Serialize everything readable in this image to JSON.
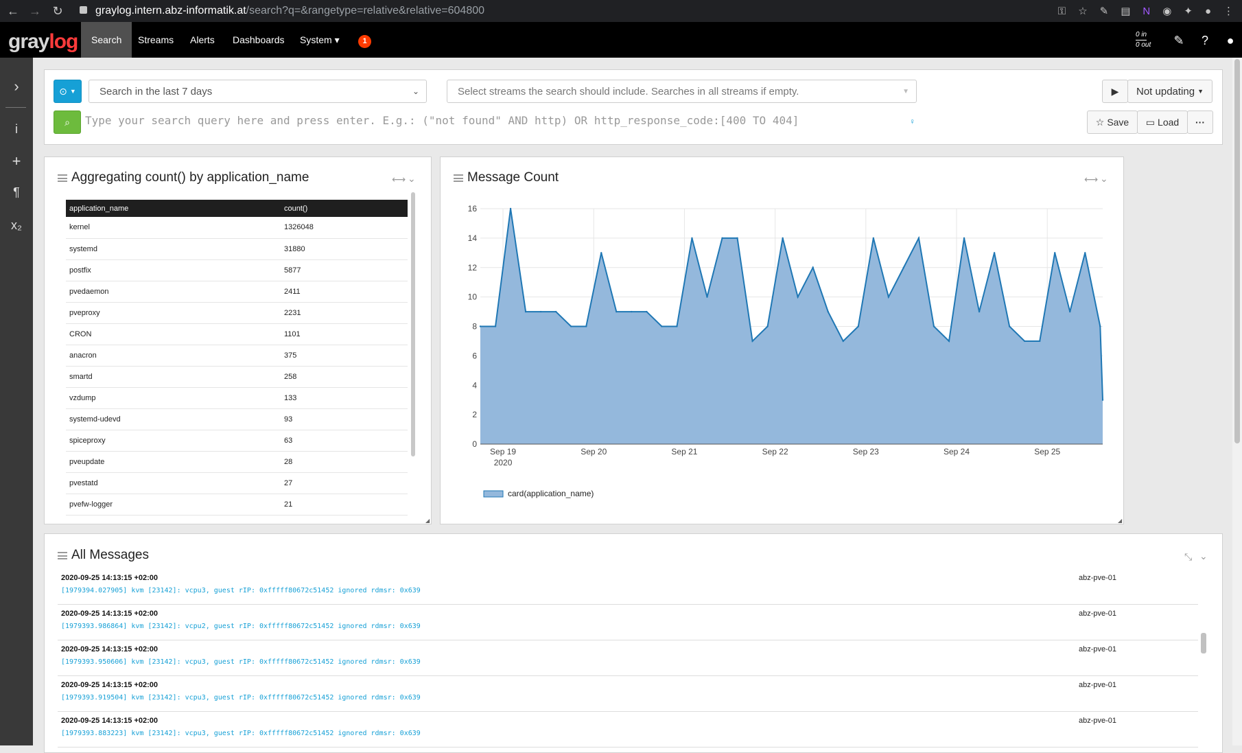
{
  "browser": {
    "url_host": "graylog.intern.abz-informatik.at",
    "url_path": "/search?q=&rangetype=relative&relative=604800"
  },
  "app": {
    "logo_gray": "gray",
    "logo_red": "log"
  },
  "nav": {
    "items": [
      "Search",
      "Streams",
      "Alerts",
      "Dashboards",
      "System ▾"
    ],
    "notifications": "1",
    "throughput_in": "0 in",
    "throughput_out": "0 out"
  },
  "search": {
    "range_button_icon": "clock-icon",
    "range_value": "Search in the last 7 days",
    "streams_placeholder": "Select streams the search should include. Searches in all streams if empty.",
    "query_placeholder": "Type your search query here and press enter. E.g.: (\"not found\" AND http) OR http_response_code:[400 TO 404]",
    "refresh_label": "Not updating",
    "save_label": "Save",
    "load_label": "Load",
    "more_label": "···"
  },
  "widgets": {
    "aggregation": {
      "title": "Aggregating count() by application_name",
      "columns": [
        "application_name",
        "count()"
      ],
      "rows": [
        [
          "kernel",
          "1326048"
        ],
        [
          "systemd",
          "31880"
        ],
        [
          "postfix",
          "5877"
        ],
        [
          "pvedaemon",
          "2411"
        ],
        [
          "pveproxy",
          "2231"
        ],
        [
          "CRON",
          "1101"
        ],
        [
          "anacron",
          "375"
        ],
        [
          "smartd",
          "258"
        ],
        [
          "vzdump",
          "133"
        ],
        [
          "systemd-udevd",
          "93"
        ],
        [
          "spiceproxy",
          "63"
        ],
        [
          "pveupdate",
          "28"
        ],
        [
          "pvestatd",
          "27"
        ],
        [
          "pvefw-logger",
          "21"
        ]
      ]
    },
    "message_count": {
      "title": "Message Count"
    },
    "all_messages": {
      "title": "All Messages",
      "messages": [
        {
          "timestamp": "2020-09-25 14:13:15 +02:00",
          "message": "[1979394.027905] kvm [23142]: vcpu3, guest rIP: 0xfffff80672c51452 ignored rdmsr: 0x639",
          "source": "abz-pve-01"
        },
        {
          "timestamp": "2020-09-25 14:13:15 +02:00",
          "message": "[1979393.986864] kvm [23142]: vcpu2, guest rIP: 0xfffff80672c51452 ignored rdmsr: 0x639",
          "source": "abz-pve-01"
        },
        {
          "timestamp": "2020-09-25 14:13:15 +02:00",
          "message": "[1979393.950606] kvm [23142]: vcpu3, guest rIP: 0xfffff80672c51452 ignored rdmsr: 0x639",
          "source": "abz-pve-01"
        },
        {
          "timestamp": "2020-09-25 14:13:15 +02:00",
          "message": "[1979393.919504] kvm [23142]: vcpu3, guest rIP: 0xfffff80672c51452 ignored rdmsr: 0x639",
          "source": "abz-pve-01"
        },
        {
          "timestamp": "2020-09-25 14:13:15 +02:00",
          "message": "[1979393.883223] kvm [23142]: vcpu3, guest rIP: 0xfffff80672c51452 ignored rdmsr: 0x639",
          "source": "abz-pve-01"
        }
      ]
    }
  },
  "chart_data": {
    "type": "area",
    "title": "",
    "xlabel": "",
    "ylabel": "",
    "x_tick_labels": [
      "Sep 19\n2020",
      "Sep 20",
      "Sep 21",
      "Sep 22",
      "Sep 23",
      "Sep 24",
      "Sep 25"
    ],
    "ylim": [
      0,
      16
    ],
    "y_ticks": [
      0,
      2,
      4,
      6,
      8,
      10,
      12,
      14,
      16
    ],
    "grid": true,
    "legend_position": "bottom-left",
    "color": "#1f77b4",
    "fill_color": "#94b8dc",
    "series": [
      {
        "name": "card(application_name)",
        "x": [
          "2020-09-18 18:00",
          "2020-09-18 22:00",
          "2020-09-19 02:00",
          "2020-09-19 06:00",
          "2020-09-19 10:00",
          "2020-09-19 14:00",
          "2020-09-19 18:00",
          "2020-09-19 22:00",
          "2020-09-20 02:00",
          "2020-09-20 06:00",
          "2020-09-20 10:00",
          "2020-09-20 14:00",
          "2020-09-20 18:00",
          "2020-09-20 22:00",
          "2020-09-21 02:00",
          "2020-09-21 06:00",
          "2020-09-21 10:00",
          "2020-09-21 14:00",
          "2020-09-21 18:00",
          "2020-09-21 22:00",
          "2020-09-22 02:00",
          "2020-09-22 06:00",
          "2020-09-22 10:00",
          "2020-09-22 14:00",
          "2020-09-22 18:00",
          "2020-09-22 22:00",
          "2020-09-23 02:00",
          "2020-09-23 06:00",
          "2020-09-23 10:00",
          "2020-09-23 14:00",
          "2020-09-23 18:00",
          "2020-09-23 22:00",
          "2020-09-24 02:00",
          "2020-09-24 06:00",
          "2020-09-24 10:00",
          "2020-09-24 14:00",
          "2020-09-24 18:00",
          "2020-09-24 22:00",
          "2020-09-25 02:00",
          "2020-09-25 06:00",
          "2020-09-25 10:00",
          "2020-09-25 14:00",
          "2020-09-25 14:40"
        ],
        "values": [
          8,
          8,
          16,
          9,
          9,
          9,
          8,
          8,
          13,
          9,
          9,
          9,
          8,
          8,
          14,
          10,
          14,
          14,
          7,
          8,
          14,
          10,
          12,
          9,
          7,
          8,
          14,
          10,
          12,
          14,
          8,
          7,
          14,
          9,
          13,
          8,
          7,
          7,
          13,
          9,
          13,
          8,
          3
        ]
      }
    ]
  }
}
